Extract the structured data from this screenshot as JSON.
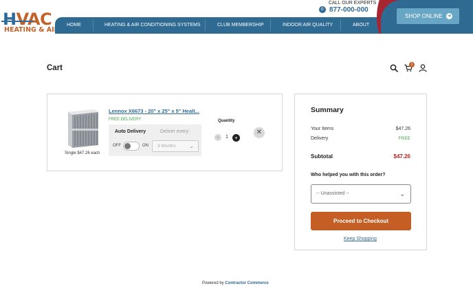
{
  "brand": {
    "logo_main": "VAC",
    "logo_initial": "H",
    "logo_sub": "HEATING & AIR",
    "accent_blue": "#2f6a93",
    "accent_orange": "#c45e25"
  },
  "header": {
    "call_label": "CALL OUR EXPERTS",
    "phone": "877-000-000",
    "shop_online": "SHOP ONLINE",
    "nav": [
      "HOME",
      "HEATING & AIR CONDITIONING SYSTEMS",
      "CLUB MEMBERSHIP",
      "INDOOR AIR QUALITY",
      "ABOUT"
    ]
  },
  "cart": {
    "title": "Cart",
    "badge_count": "1"
  },
  "item": {
    "name": "Lennox X6673 - 20\" x 25\" x 5\" Healt...",
    "delivery": "FREE DELIVERY",
    "single_price": "Single $47.26 each",
    "auto_delivery_label": "Auto Delivery",
    "deliver_every_label": "Deliver every:",
    "toggle_off": "OFF",
    "toggle_on": "ON",
    "frequency": "3 Months",
    "quantity_label": "Quantity",
    "quantity": "1",
    "minus": "-",
    "plus": "+"
  },
  "summary": {
    "title": "Summary",
    "your_items_label": "Your Items",
    "your_items_value": "$47.26",
    "delivery_label": "Delivery",
    "delivery_value": "FREE",
    "subtotal_label": "Subtotal",
    "subtotal_value": "$47.26",
    "helped_label": "Who helped you with this order?",
    "helper_selected": "-- Unassisted --",
    "checkout": "Proceed to Checkout",
    "keep_shopping": "Keep Shopping"
  },
  "footer": {
    "powered_by": "Powered by",
    "provider": "Contractor Commerce"
  }
}
